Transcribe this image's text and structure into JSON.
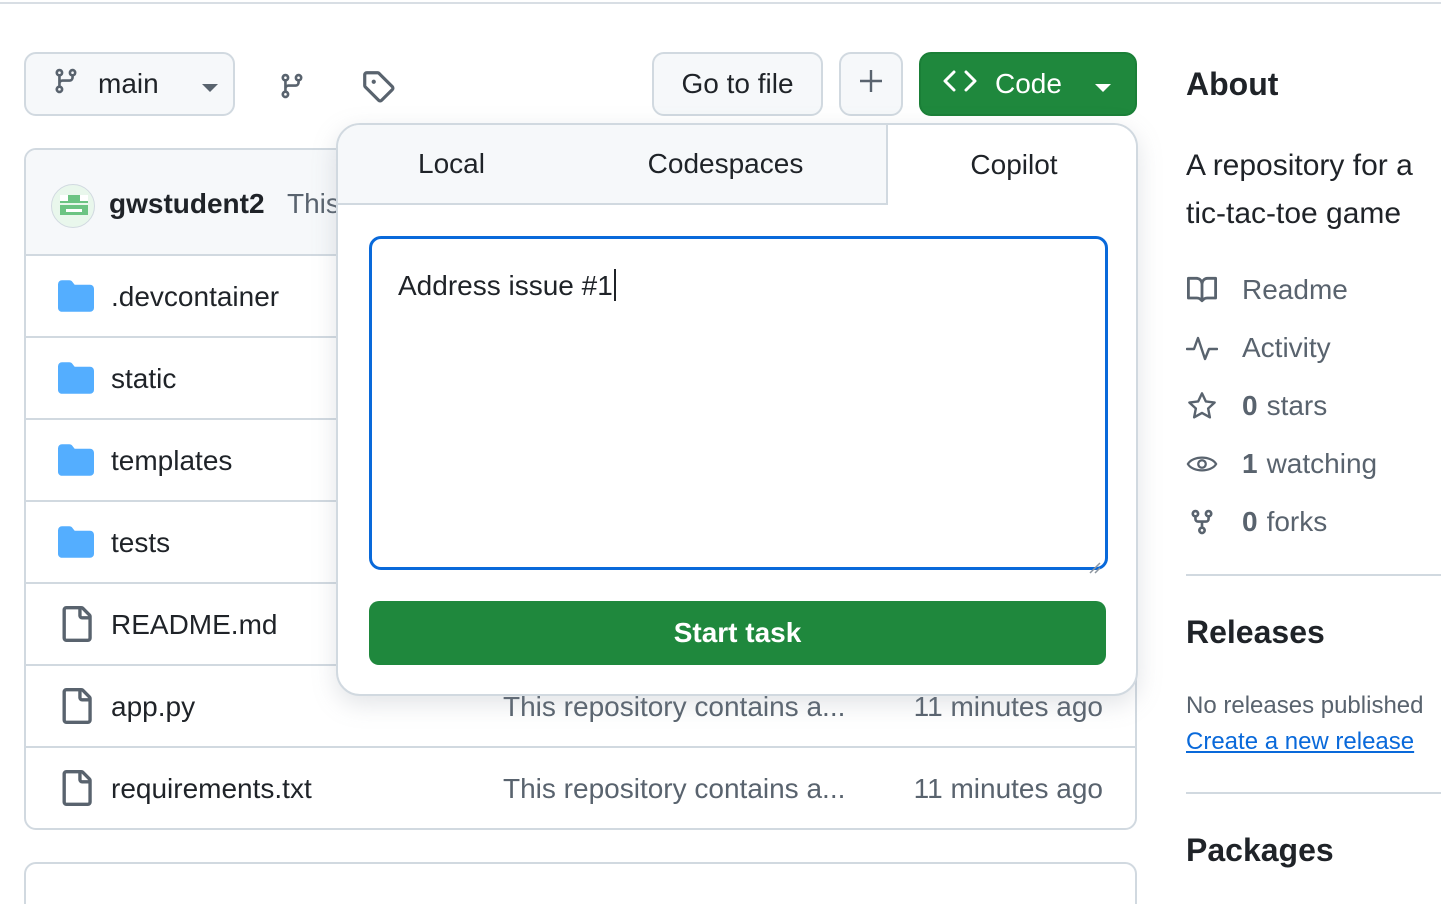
{
  "toolbar": {
    "branch_label": "main",
    "goto_label": "Go to file",
    "plus_label": "+",
    "code_label": "Code"
  },
  "commit": {
    "author": "gwstudent2",
    "message_prefix": "This"
  },
  "files": [
    {
      "name": ".devcontainer",
      "type": "folder",
      "commit": "",
      "time": ""
    },
    {
      "name": "static",
      "type": "folder",
      "commit": "",
      "time": ""
    },
    {
      "name": "templates",
      "type": "folder",
      "commit": "",
      "time": ""
    },
    {
      "name": "tests",
      "type": "folder",
      "commit": "",
      "time": ""
    },
    {
      "name": "README.md",
      "type": "file",
      "commit": "",
      "time": ""
    },
    {
      "name": "app.py",
      "type": "file",
      "commit": "This repository contains a...",
      "time": "11 minutes ago"
    },
    {
      "name": "requirements.txt",
      "type": "file",
      "commit": "This repository contains a...",
      "time": "11 minutes ago"
    }
  ],
  "popover": {
    "tabs": [
      "Local",
      "Codespaces",
      "Copilot"
    ],
    "active_tab": "Copilot",
    "task_value": "Address issue #1",
    "start_label": "Start task"
  },
  "about": {
    "heading": "About",
    "description_line1": "A repository for a",
    "description_line2": "tic-tac-toe game",
    "readme": "Readme",
    "activity": "Activity",
    "stars_count": "0",
    "stars_label": "stars",
    "watching_count": "1",
    "watching_label": "watching",
    "forks_count": "0",
    "forks_label": "forks"
  },
  "releases": {
    "heading": "Releases",
    "none_text": "No releases published",
    "create_link": "Create a new release"
  },
  "packages": {
    "heading": "Packages"
  },
  "colors": {
    "primary_green": "#1f883d",
    "focus_blue": "#0969da",
    "folder_blue": "#54aeff",
    "muted_text": "#59636e",
    "border": "#d1d9e0"
  }
}
